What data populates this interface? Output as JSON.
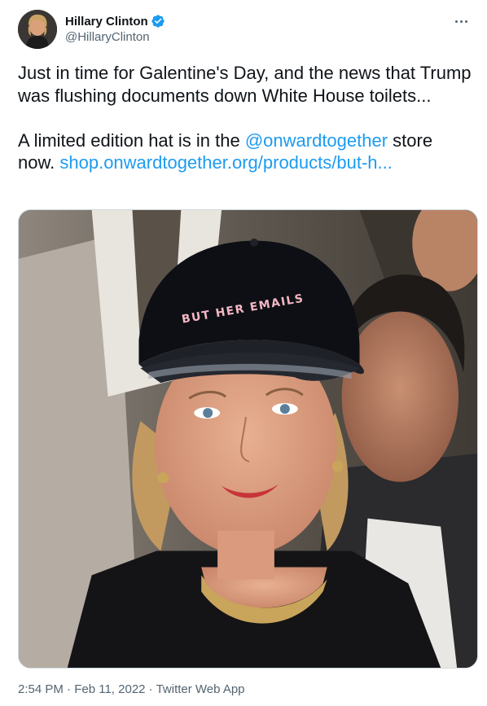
{
  "author": {
    "display_name": "Hillary Clinton",
    "handle": "@HillaryClinton",
    "verified_icon": "verified-badge-icon",
    "avatar_icon": "profile-photo"
  },
  "menu": {
    "more_icon": "more-options-icon"
  },
  "tweet": {
    "line1": "Just in time for Galentine's Day, and the news that Trump was flushing documents down White House toilets...",
    "line2_prefix": "A limited edition hat is in the ",
    "mention": "@onwardtogether",
    "line2_mid": " store now. ",
    "url": "shop.onwardtogether.org/products/but-h..."
  },
  "media": {
    "hat_text": "BUT HER EMAILS"
  },
  "meta": {
    "time": "2:54 PM",
    "separator1": " · ",
    "date": "Feb 11, 2022",
    "separator2": " · ",
    "source": "Twitter Web App"
  },
  "colors": {
    "text": "#0f1419",
    "secondary": "#536471",
    "link": "#1d9bf0",
    "verified": "#1d9bf0"
  }
}
